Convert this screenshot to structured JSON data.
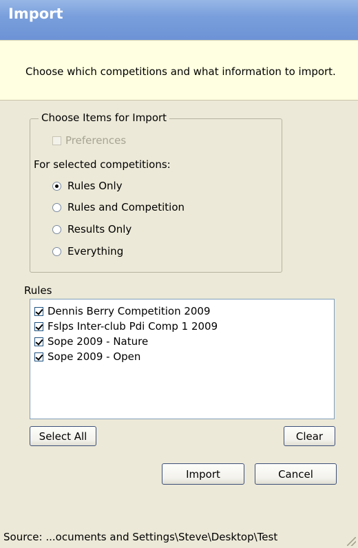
{
  "window": {
    "title": "Import"
  },
  "header": {
    "description": "Choose which competitions and what information to import."
  },
  "import_group": {
    "legend": "Choose Items for Import",
    "preferences_label": "Preferences",
    "preferences_checked": false,
    "preferences_enabled": false,
    "competitions_label": "For selected competitions:",
    "options": [
      {
        "label": "Rules Only",
        "selected": true
      },
      {
        "label": "Rules and Competition",
        "selected": false
      },
      {
        "label": "Results Only",
        "selected": false
      },
      {
        "label": "Everything",
        "selected": false
      }
    ]
  },
  "rules": {
    "label": "Rules",
    "items": [
      {
        "label": "Dennis Berry Competition 2009",
        "checked": true
      },
      {
        "label": "Fslps Inter-club Pdi Comp 1 2009",
        "checked": true
      },
      {
        "label": "Sope 2009 - Nature",
        "checked": true
      },
      {
        "label": "Sope 2009 - Open",
        "checked": true
      }
    ]
  },
  "buttons": {
    "select_all": "Select All",
    "clear": "Clear",
    "import": "Import",
    "cancel": "Cancel"
  },
  "status": {
    "source": "Source: ...ocuments and Settings\\Steve\\Desktop\\Test"
  }
}
